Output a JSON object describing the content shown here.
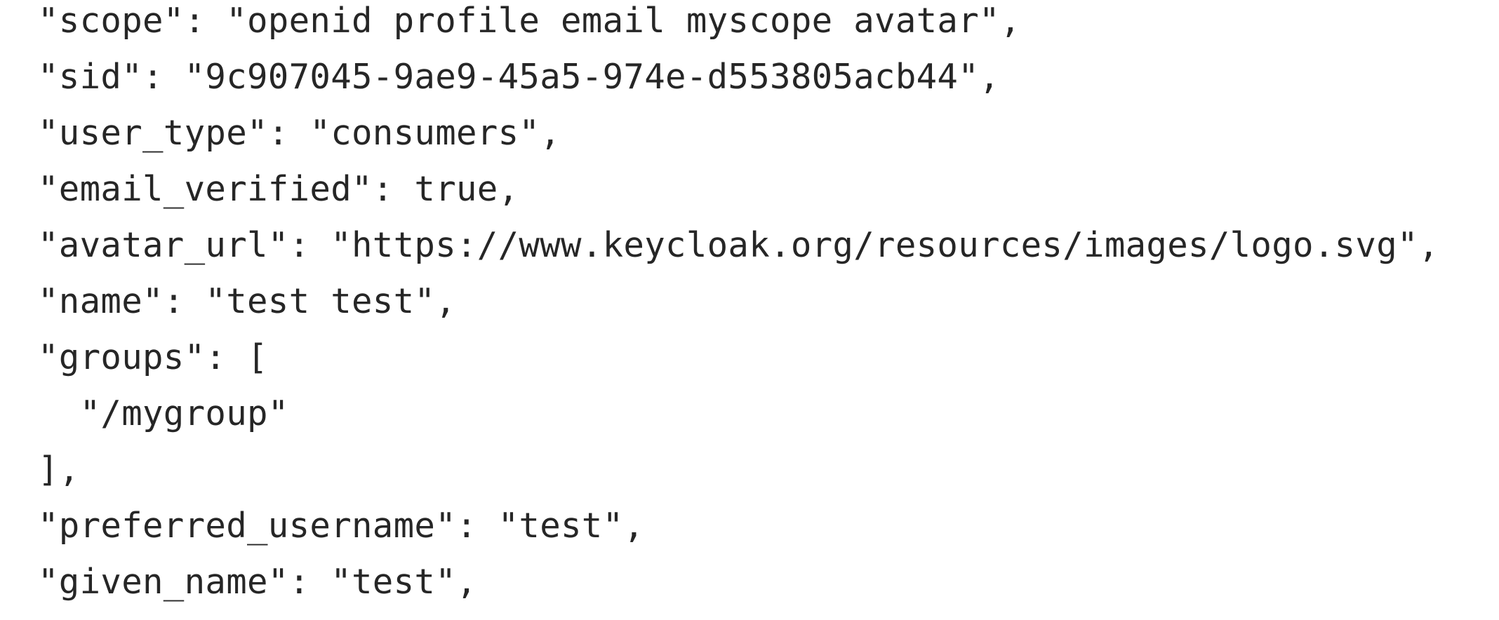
{
  "json_viewer": {
    "lines": [
      "},",
      "\"scope\": \"openid profile email myscope avatar\",",
      "\"sid\": \"9c907045-9ae9-45a5-974e-d553805acb44\",",
      "\"user_type\": \"consumers\",",
      "\"email_verified\": true,",
      "\"avatar_url\": \"https://www.keycloak.org/resources/images/logo.svg\",",
      "\"name\": \"test test\",",
      "\"groups\": [",
      "  \"/mygroup\"",
      "],",
      "\"preferred_username\": \"test\",",
      "\"given_name\": \"test\","
    ]
  }
}
